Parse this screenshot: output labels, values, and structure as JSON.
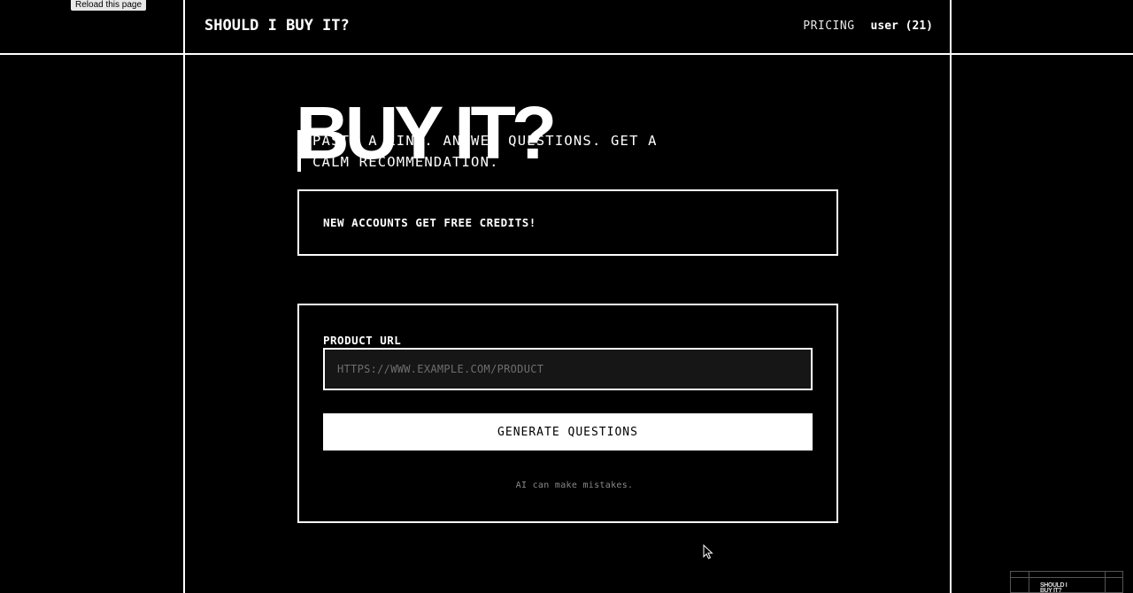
{
  "tooltip": {
    "reload": "Reload this page"
  },
  "header": {
    "brand": "SHOULD I BUY IT?",
    "nav": {
      "pricing": "PRICING",
      "user": "user (21)"
    }
  },
  "hero": {
    "title": "BUY IT?",
    "tagline_line1": "PASTE A LINK. ANSWER QUESTIONS. GET A",
    "tagline_line2": "CALM RECOMMENDATION."
  },
  "promo": {
    "text": "NEW ACCOUNTS GET FREE CREDITS!"
  },
  "form": {
    "url_label": "PRODUCT URL",
    "url_placeholder": "HTTPS://WWW.EXAMPLE.COM/PRODUCT",
    "url_value": "",
    "submit_label": "GENERATE QUESTIONS",
    "disclaimer": "AI can make mistakes."
  },
  "thumbnail": {
    "title": "SHOULD I\nBUY IT?"
  },
  "colors": {
    "background": "#000000",
    "foreground": "#ffffff",
    "input_bg": "#161616",
    "muted_text": "#8a8a8a"
  },
  "icons": {
    "cursor": "arrow-cursor-icon"
  }
}
